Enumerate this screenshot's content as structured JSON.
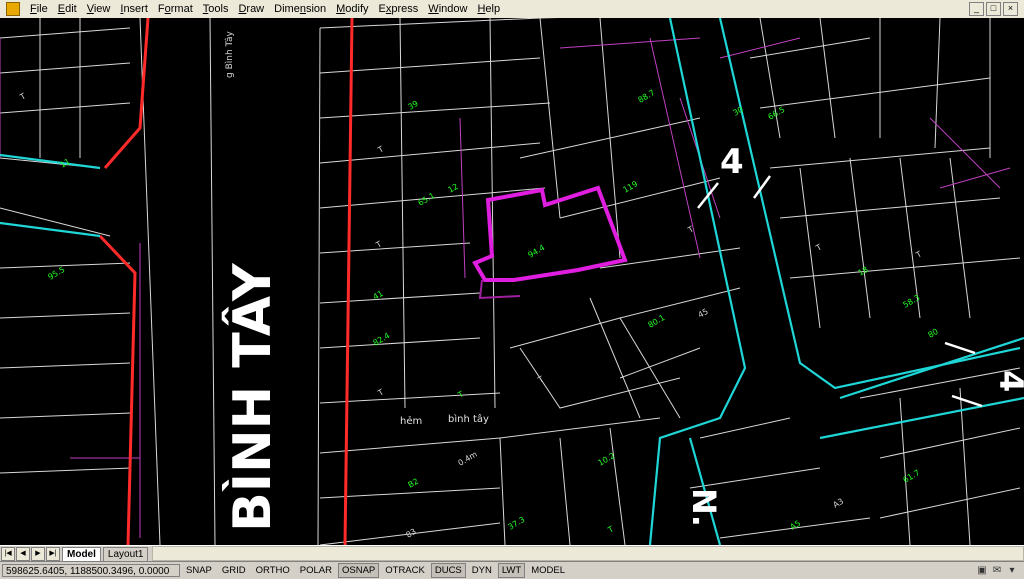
{
  "menu": {
    "items": [
      {
        "label": "File",
        "u": "F",
        "rest": "ile"
      },
      {
        "label": "Edit",
        "u": "E",
        "rest": "dit"
      },
      {
        "label": "View",
        "u": "V",
        "rest": "iew"
      },
      {
        "label": "Insert",
        "u": "I",
        "rest": "nsert"
      },
      {
        "label": "Format",
        "u": "o",
        "pre": "F",
        "rest": "rmat"
      },
      {
        "label": "Tools",
        "u": "T",
        "rest": "ools"
      },
      {
        "label": "Draw",
        "u": "D",
        "rest": "raw"
      },
      {
        "label": "Dimension",
        "u": "n",
        "pre": "Dime",
        "rest": "sion"
      },
      {
        "label": "Modify",
        "u": "M",
        "rest": "odify"
      },
      {
        "label": "Express",
        "u": "x",
        "pre": "E",
        "rest": "press"
      },
      {
        "label": "Window",
        "u": "W",
        "rest": "indow"
      },
      {
        "label": "Help",
        "u": "H",
        "rest": "elp"
      }
    ]
  },
  "window_controls": {
    "minimize": "_",
    "restore": "□",
    "close": "×"
  },
  "drawing": {
    "street_main": "G BÌNH TÂY",
    "street_small": "g Bình Tây",
    "alley_label_1": "hẻm",
    "alley_label_2": "bình tây",
    "road_label_4": "4",
    "road_label_n": "N.",
    "parcel_labels": [
      "T",
      "11",
      "95.5",
      "T",
      "39",
      "65.1",
      "T",
      "41",
      "82.4",
      "T",
      "12",
      "94.4",
      "T",
      "119",
      "88.7",
      "T",
      "30",
      "66.5",
      "T",
      "18",
      "58.3",
      "T",
      "80",
      "61.7",
      "A3",
      "A5",
      "B2",
      "0.4m",
      "10.2",
      "T",
      "45",
      "80.1",
      "T",
      "83",
      "37.3",
      "T",
      "113",
      "50.6"
    ],
    "colors": {
      "boundary": "#ff2a2a",
      "road": "#1fd6d6",
      "highlight": "#e01ee0",
      "parcel": "#d8d8d8",
      "label": "#22ff22",
      "lot": "#c040c0"
    }
  },
  "tabs": {
    "model": "Model",
    "layout1": "Layout1"
  },
  "status": {
    "coords": "598625.6405, 1188500.3496, 0.0000",
    "toggles": [
      {
        "label": "SNAP",
        "on": false
      },
      {
        "label": "GRID",
        "on": false
      },
      {
        "label": "ORTHO",
        "on": false
      },
      {
        "label": "POLAR",
        "on": false
      },
      {
        "label": "OSNAP",
        "on": true
      },
      {
        "label": "OTRACK",
        "on": false
      },
      {
        "label": "DUCS",
        "on": true
      },
      {
        "label": "DYN",
        "on": false
      },
      {
        "label": "LWT",
        "on": true
      },
      {
        "label": "MODEL",
        "on": false
      }
    ]
  }
}
